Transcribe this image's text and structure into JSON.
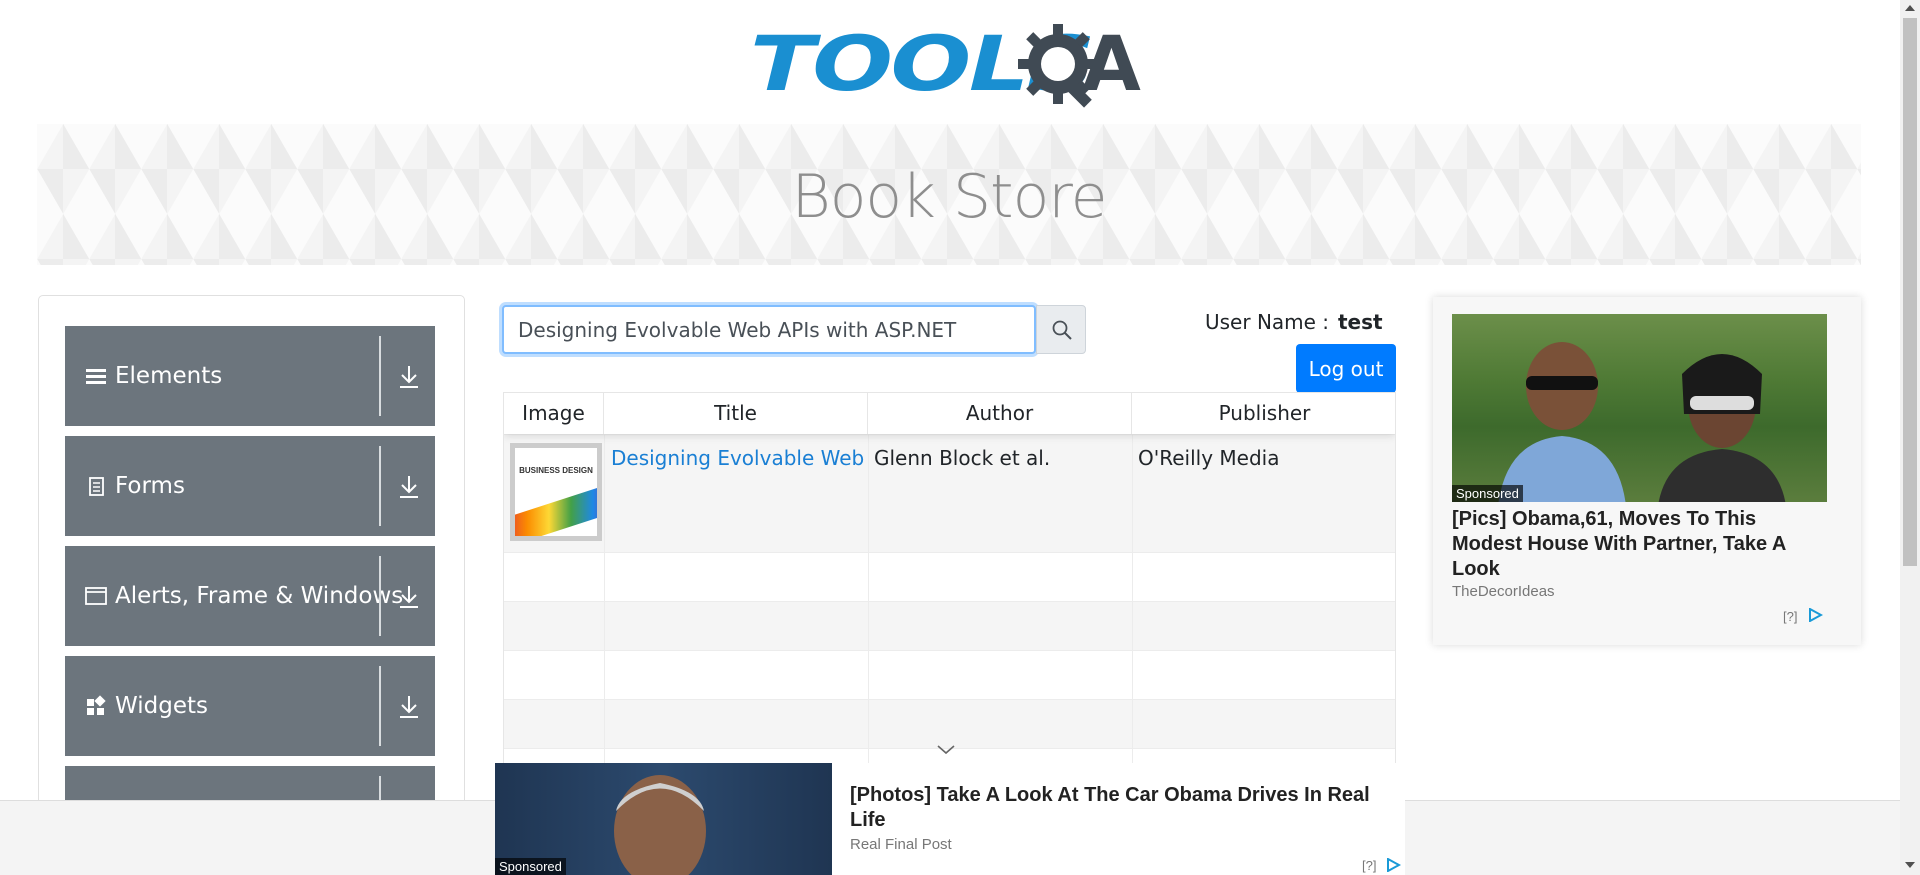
{
  "logo": {
    "text_part1": "TOOLS",
    "text_part2": "A"
  },
  "banner": {
    "title": "Book Store"
  },
  "sidebar": {
    "groups": [
      {
        "label": "Elements",
        "icon": "hamburger-icon"
      },
      {
        "label": "Forms",
        "icon": "document-icon"
      },
      {
        "label": "Alerts, Frame & Windows",
        "icon": "window-icon"
      },
      {
        "label": "Widgets",
        "icon": "widgets-icon"
      },
      {
        "label": "",
        "icon": ""
      }
    ]
  },
  "search": {
    "value": "Designing Evolvable Web APIs with ASP.NET"
  },
  "user": {
    "label": "User Name :",
    "value": "test",
    "logout_label": "Log out"
  },
  "table": {
    "headers": [
      "Image",
      "Title",
      "Author",
      "Publisher"
    ],
    "rows": [
      {
        "cover_title": "BUSINESS DESIGN",
        "title": "Designing Evolvable Web APIs with ASP.NET",
        "author": "Glenn Block et al.",
        "publisher": "O'Reilly Media"
      }
    ]
  },
  "right_ad": {
    "sponsored": "Sponsored",
    "title": "[Pics] Obama,61, Moves To This Modest House With Partner, Take A Look",
    "source": "TheDecorIdeas",
    "info": "[?]"
  },
  "bottom_ad": {
    "sponsored": "Sponsored",
    "title": "[Photos] Take A Look At The Car Obama Drives In Real Life",
    "source": "Real Final Post",
    "info": "[?]"
  },
  "colors": {
    "accent": "#007bff",
    "group_bg": "#6c757d",
    "link": "#1a7fd4",
    "logo_blue": "#1a8fd1"
  }
}
